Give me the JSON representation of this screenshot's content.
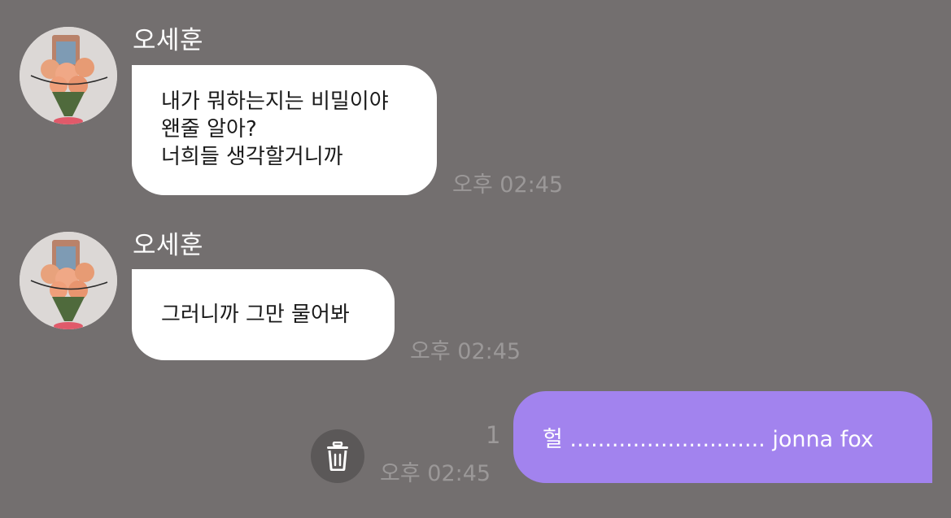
{
  "messages": [
    {
      "sender": "오세훈",
      "lines": [
        "내가 뭐하는지는 비밀이야",
        "왠줄 알아?",
        "너희들 생각할거니까"
      ],
      "time": "오후 02:45"
    },
    {
      "sender": "오세훈",
      "lines": [
        "그러니까 그만 물어봐"
      ],
      "time": "오후 02:45"
    }
  ],
  "outgoing": {
    "text": "헐 ............................ jonna fox",
    "time": "오후 02:45",
    "unread_count": "1"
  },
  "icons": {
    "delete": "trash-icon"
  },
  "colors": {
    "background": "#736f6f",
    "outgoing_bubble": "#a283ee",
    "incoming_bubble": "#ffffff",
    "time": "#9b9898"
  }
}
